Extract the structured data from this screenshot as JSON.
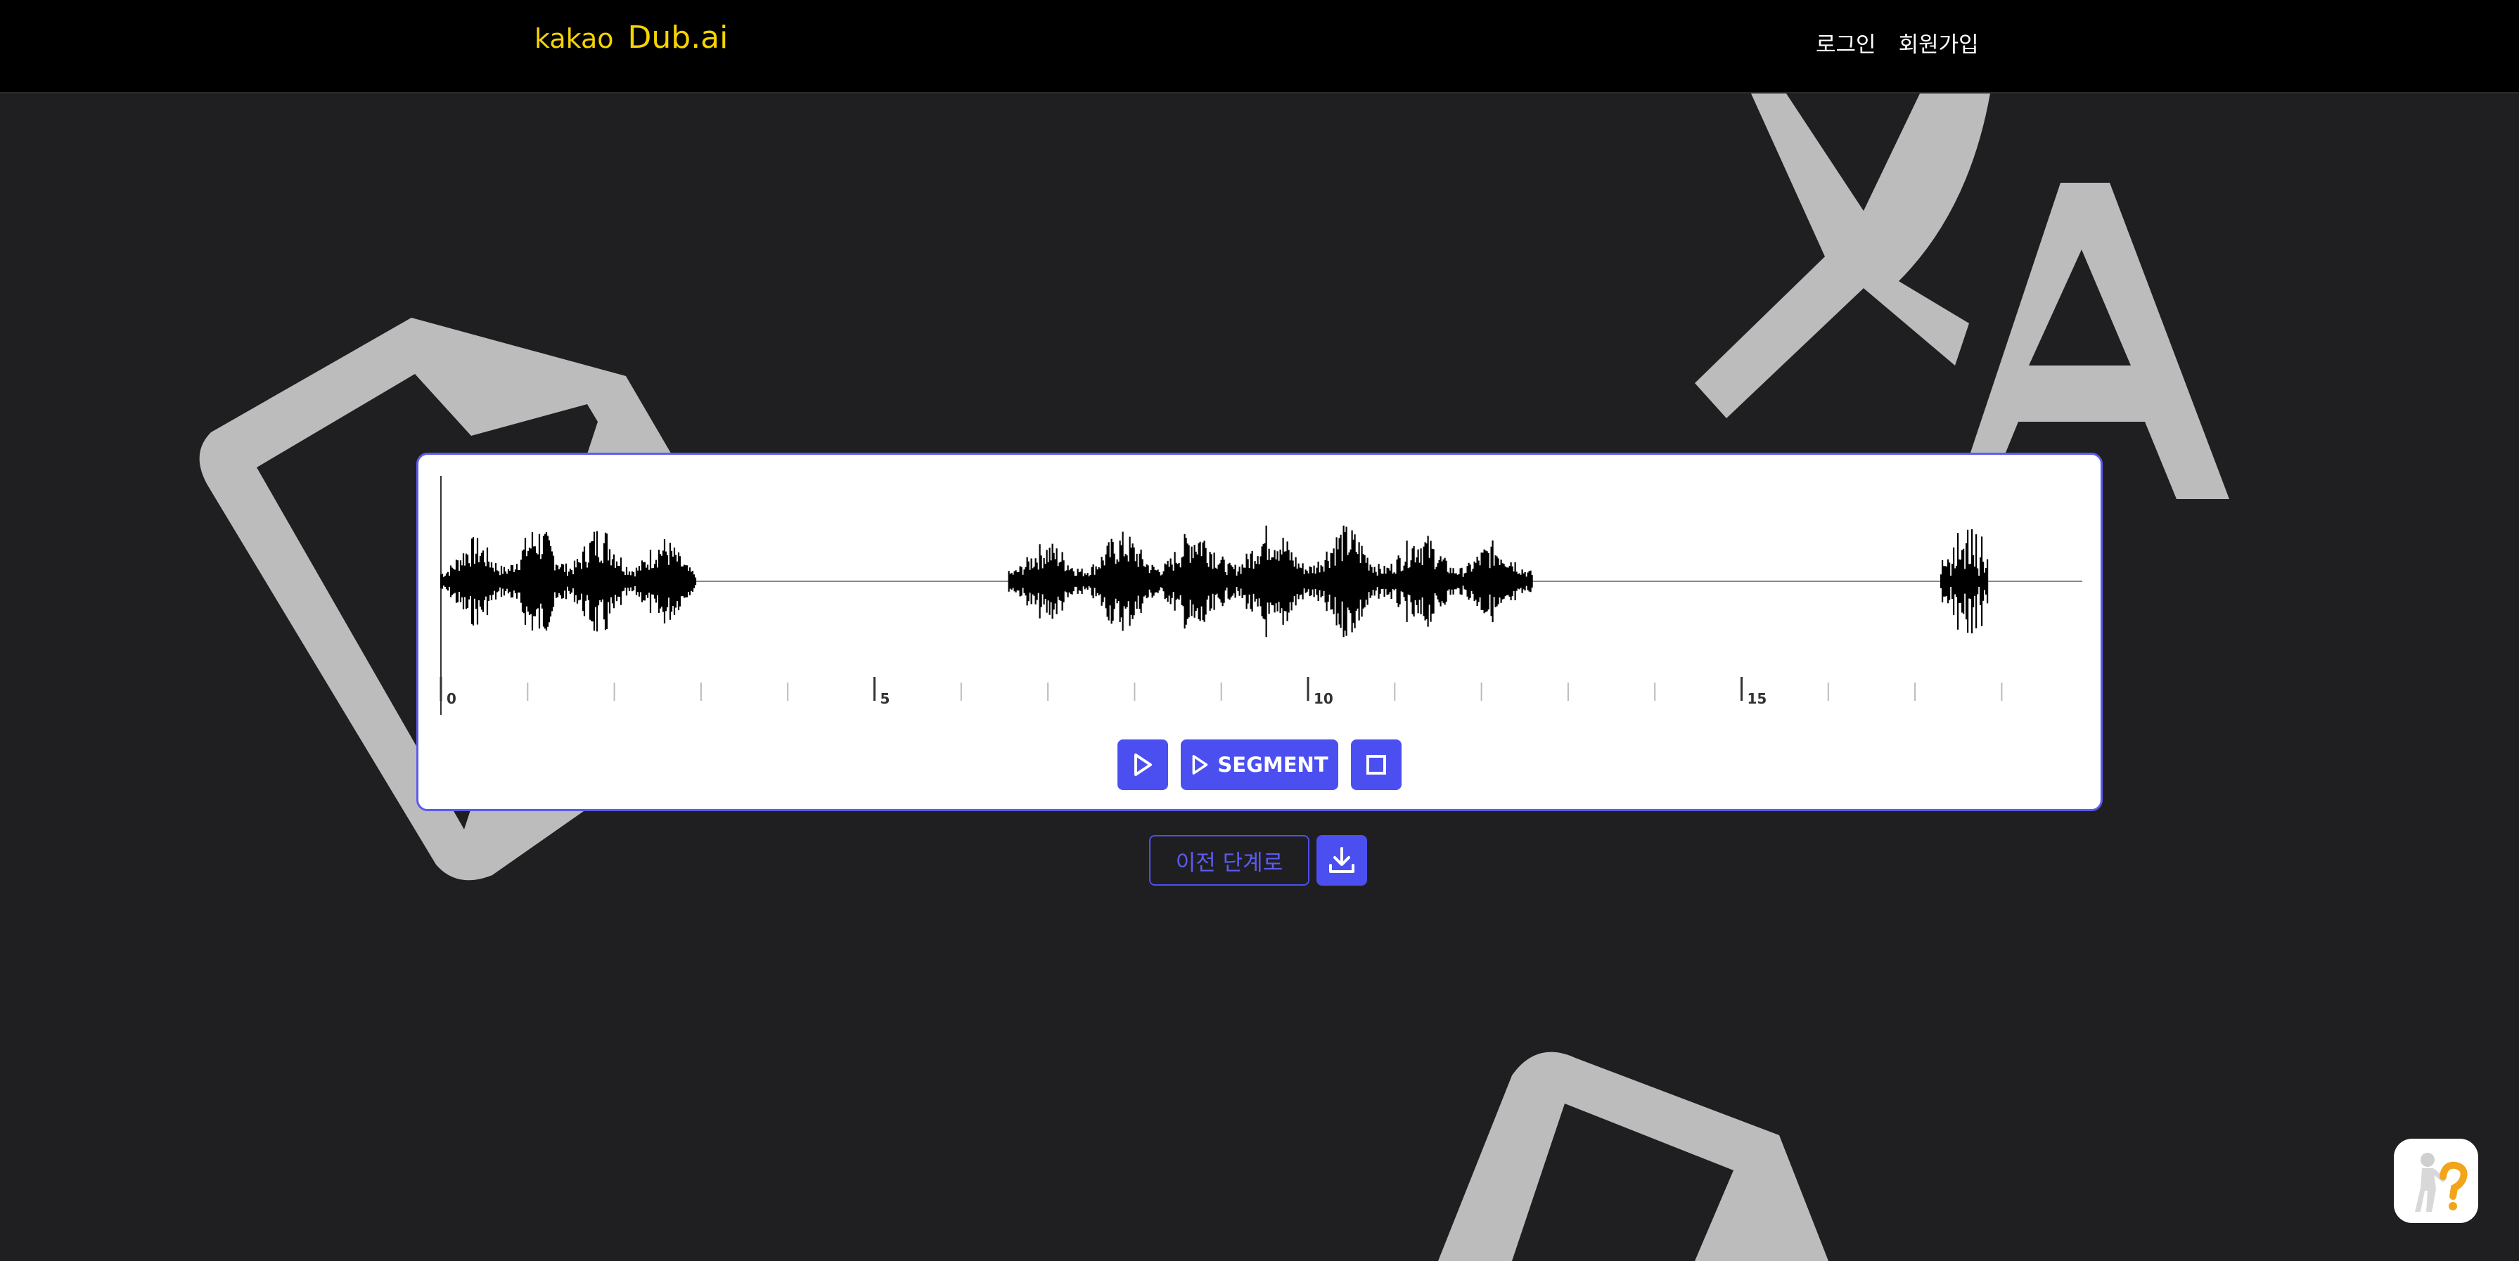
{
  "header": {
    "brand_prefix": "kakao",
    "brand_name": "Dub.ai",
    "login_label": "로그인",
    "signup_label": "회원가입"
  },
  "waveform": {
    "ticks": [
      {
        "label": "0",
        "major": true
      },
      {
        "label": "",
        "major": false
      },
      {
        "label": "",
        "major": false
      },
      {
        "label": "",
        "major": false
      },
      {
        "label": "",
        "major": false
      },
      {
        "label": "5",
        "major": true
      },
      {
        "label": "",
        "major": false
      },
      {
        "label": "",
        "major": false
      },
      {
        "label": "",
        "major": false
      },
      {
        "label": "",
        "major": false
      },
      {
        "label": "10",
        "major": true
      },
      {
        "label": "",
        "major": false
      },
      {
        "label": "",
        "major": false
      },
      {
        "label": "",
        "major": false
      },
      {
        "label": "",
        "major": false
      },
      {
        "label": "15",
        "major": true
      },
      {
        "label": "",
        "major": false
      },
      {
        "label": "",
        "major": false
      },
      {
        "label": "",
        "major": false
      }
    ],
    "segments": [
      {
        "start": 0.0,
        "end": 2.95
      },
      {
        "start": 6.55,
        "end": 12.6
      },
      {
        "start": 17.3,
        "end": 17.85
      }
    ],
    "duration": 18.9
  },
  "controls": {
    "segment_label": "SEGMENT"
  },
  "actions": {
    "prev_label": "이전 단계로"
  },
  "colors": {
    "accent": "#4c4ff0",
    "brand": "#f5d400",
    "background": "#1f1f21",
    "deco": "#bcbcbc"
  }
}
